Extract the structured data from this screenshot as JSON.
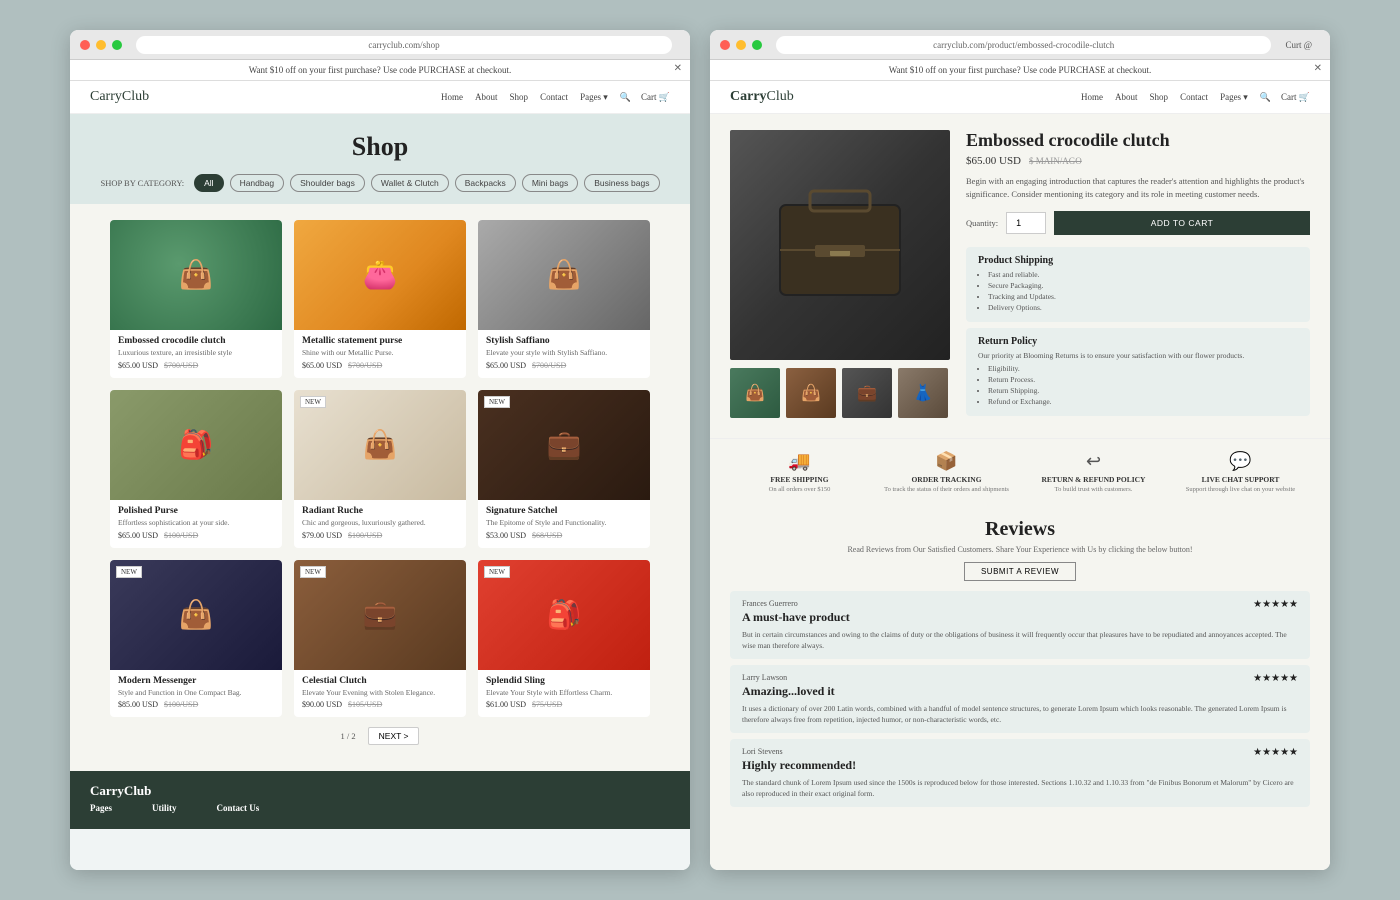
{
  "browser": {
    "promo_text": "Want $10 off on your first purchase? Use code PURCHASE at checkout.",
    "close_label": "✕"
  },
  "nav": {
    "logo": "Carry",
    "logo_suffix": "Club",
    "links": [
      "Home",
      "About",
      "Shop",
      "Contact",
      "Pages ▾"
    ],
    "search_label": "🔍",
    "cart_label": "Cart 🛒"
  },
  "shop": {
    "title": "Shop",
    "category_label": "SHOP BY CATEGORY:",
    "categories": [
      "All",
      "Handbag",
      "Shoulder bags",
      "Wallet & Clutch",
      "Backpacks",
      "Mini bags",
      "Business bags"
    ]
  },
  "products": [
    {
      "name": "Embossed crocodile clutch",
      "desc": "Luxurious texture, an irresistible style",
      "price": "$65.00 USD",
      "old_price": "$700/USD",
      "is_new": false,
      "color": "green"
    },
    {
      "name": "Metallic statement purse",
      "desc": "Shine with our Metallic Purse.",
      "price": "$65.00 USD",
      "old_price": "$700/USD",
      "is_new": false,
      "color": "orange"
    },
    {
      "name": "Stylish Saffiano",
      "desc": "Elevate your style with Stylish Saffiano.",
      "price": "$65.00 USD",
      "old_price": "$700/USD",
      "is_new": false,
      "color": "gray"
    },
    {
      "name": "Polished Purse",
      "desc": "Effortless sophistication at your side.",
      "price": "$65.00 USD",
      "old_price": "$100/USD",
      "is_new": false,
      "color": "khaki"
    },
    {
      "name": "Radiant Ruche",
      "desc": "Chic and gorgeous, luxuriously gathered.",
      "price": "$79.00 USD",
      "old_price": "$100/USD",
      "is_new": true,
      "color": "cream"
    },
    {
      "name": "Signature Satchel",
      "desc": "The Epitome of Style and Functionality.",
      "price": "$53.00 USD",
      "old_price": "$68/USD",
      "is_new": true,
      "color": "darkbrown"
    },
    {
      "name": "Modern Messenger",
      "desc": "Style and Function in One Compact Bag.",
      "price": "$85.00 USD",
      "old_price": "$100/USD",
      "is_new": true,
      "color": "navy"
    },
    {
      "name": "Celestial Clutch",
      "desc": "Elevate Your Evening with Stolen Elegance.",
      "price": "$90.00 USD",
      "old_price": "$105/USD",
      "is_new": true,
      "color": "brownleather"
    },
    {
      "name": "Splendid Sling",
      "desc": "Elevate Your Style with Effortless Charm.",
      "price": "$61.00 USD",
      "old_price": "$75/USD",
      "is_new": true,
      "color": "red"
    }
  ],
  "pagination": {
    "current": "1 / 2",
    "next_label": "NEXT >"
  },
  "footer": {
    "logo": "CarryClub",
    "cols": [
      "Pages",
      "Utility",
      "Contact Us"
    ]
  },
  "detail": {
    "title": "Embossed crocodile clutch",
    "price": "$65.00 USD",
    "old_price": "$ MAIN/AGO",
    "desc": "Begin with an engaging introduction that captures the reader's attention and highlights the product's significance. Consider mentioning its category and its role in meeting customer needs.",
    "quantity_label": "Quantity:",
    "quantity_value": "1",
    "add_to_cart": "ADD TO CART",
    "shipping": {
      "title": "Product Shipping",
      "items": [
        "Fast and reliable.",
        "Secure Packaging.",
        "Tracking and Updates.",
        "Delivery Options."
      ]
    },
    "returns": {
      "title": "Return Policy",
      "intro": "Our priority at Blooming Returns is to ensure your satisfaction with our flower products.",
      "items": [
        "Eligibility.",
        "Return Process.",
        "Return Shipping.",
        "Refund or Exchange."
      ]
    }
  },
  "features": [
    {
      "icon": "🚚",
      "title": "FREE SHIPPING",
      "desc": "On all orders over $150"
    },
    {
      "icon": "📦",
      "title": "ORDER TRACKING",
      "desc": "To track the status of their orders and shipments"
    },
    {
      "icon": "↩",
      "title": "RETURN & REFUND POLICY",
      "desc": "To build trust with customers."
    },
    {
      "icon": "💬",
      "title": "LIVE CHAT SUPPORT",
      "desc": "Support through live chat on your website"
    }
  ],
  "reviews": {
    "title": "Reviews",
    "subtitle": "Read Reviews from Our Satisfied Customers. Share Your Experience with Us by clicking the below button!",
    "submit_label": "SUBMIT A REVIEW",
    "items": [
      {
        "name": "Frances Guerrero",
        "headline": "A must-have product",
        "stars": "★★★★★",
        "text": "But in certain circumstances and owing to the claims of duty or the obligations of business it will frequently occur that pleasures have to be repudiated and annoyances accepted. The wise man therefore always."
      },
      {
        "name": "Larry Lawson",
        "headline": "Amazing...loved it",
        "stars": "★★★★★",
        "text": "It uses a dictionary of over 200 Latin words, combined with a handful of model sentence structures, to generate Lorem Ipsum which looks reasonable. The generated Lorem Ipsum is therefore always free from repetition, injected humor, or non-characteristic words, etc."
      },
      {
        "name": "Lori Stevens",
        "headline": "Highly recommended!",
        "stars": "★★★★★",
        "text": "The standard chunk of Lorem Ipsum used since the 1500s is reproduced below for those interested. Sections 1.10.32 and 1.10.33 from \"de Finibus Bonorum et Malorum\" by Cicero are also reproduced in their exact original form."
      }
    ]
  },
  "user": {
    "label": "Curt @"
  }
}
